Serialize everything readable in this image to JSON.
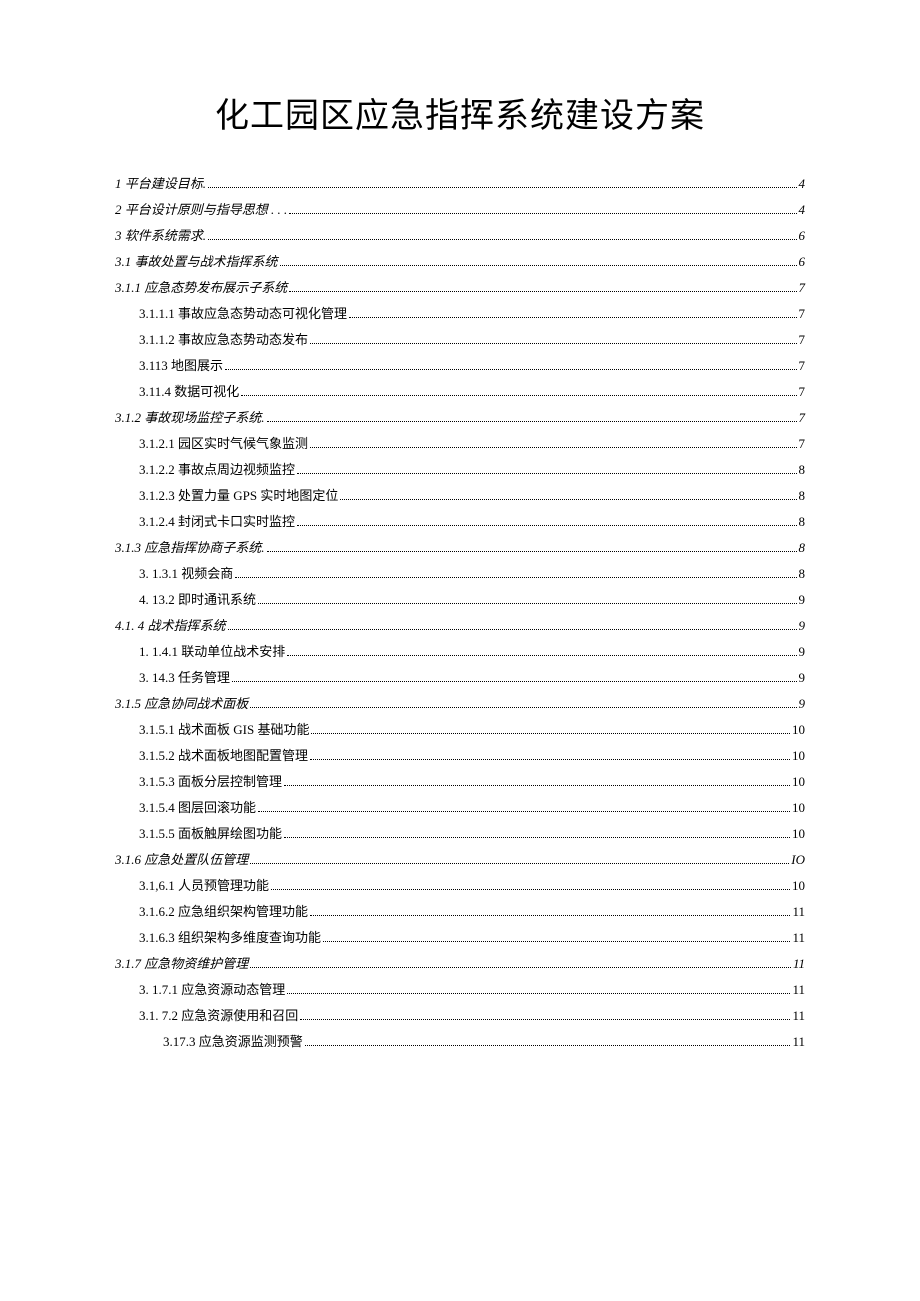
{
  "title": "化工园区应急指挥系统建设方案",
  "toc": [
    {
      "label": "1 平台建设目标.",
      "page": "4",
      "italic": true,
      "indent": 0
    },
    {
      "label": "2 平台设计原则与指导思想 . . .",
      "page": "4",
      "italic": true,
      "indent": 0
    },
    {
      "label": "3 软件系统需求.",
      "page": "6",
      "italic": true,
      "indent": 0
    },
    {
      "label": "3.1 事故处置与战术指挥系统",
      "page": "6",
      "italic": true,
      "indent": 0
    },
    {
      "label": "3.1.1 应急态势发布展示子系统",
      "page": "7",
      "italic": true,
      "indent": 0
    },
    {
      "label": "3.1.1.1 事故应急态势动态可视化管理",
      "page": "7",
      "italic": false,
      "indent": 2
    },
    {
      "label": "3.1.1.2 事故应急态势动态发布",
      "page": "7",
      "italic": false,
      "indent": 2
    },
    {
      "label": "3.113 地图展示",
      "page": "7",
      "italic": false,
      "indent": 2
    },
    {
      "label": "3.11.4 数据可视化",
      "page": "7",
      "italic": false,
      "indent": 2
    },
    {
      "label": "3.1.2 事故现场监控子系统.",
      "page": "7",
      "italic": true,
      "indent": 0
    },
    {
      "label": "3.1.2.1 园区实时气候气象监测",
      "page": "7",
      "italic": false,
      "indent": 2
    },
    {
      "label": "3.1.2.2 事故点周边视频监控",
      "page": "8",
      "italic": false,
      "indent": 2
    },
    {
      "label": "3.1.2.3 处置力量 GPS 实时地图定位",
      "page": " 8",
      "italic": false,
      "indent": 2
    },
    {
      "label": "3.1.2.4 封闭式卡口实时监控",
      "page": "8",
      "italic": false,
      "indent": 2
    },
    {
      "label": "3.1.3 应急指挥协商子系统.",
      "page": "8",
      "italic": true,
      "indent": 0
    },
    {
      "label": "3.   1.3.1 视频会商",
      "page": " 8",
      "italic": false,
      "indent": 2
    },
    {
      "label": "4.   13.2 即时通讯系统",
      "page": "9",
      "italic": false,
      "indent": 2
    },
    {
      "label": "4.1.    4 战术指挥系统",
      "page": "9",
      "italic": true,
      "indent": 0
    },
    {
      "label": "1.   1.4.1 联动单位战术安排",
      "page": "9",
      "italic": false,
      "indent": 2
    },
    {
      "label": "3.   14.3 任务管理",
      "page": "9",
      "italic": false,
      "indent": 2
    },
    {
      "label": "3.1.5 应急协同战术面板",
      "page": "9",
      "italic": true,
      "indent": 0
    },
    {
      "label": "3.1.5.1 战术面板 GIS 基础功能",
      "page": "10",
      "italic": false,
      "indent": 2
    },
    {
      "label": "3.1.5.2 战术面板地图配置管理",
      "page": "10",
      "italic": false,
      "indent": 2
    },
    {
      "label": "3.1.5.3 面板分层控制管理",
      "page": " 10",
      "italic": false,
      "indent": 2
    },
    {
      "label": "3.1.5.4 图层回滚功能",
      "page": "10",
      "italic": false,
      "indent": 2
    },
    {
      "label": "3.1.5.5 面板触屏绘图功能",
      "page": "10",
      "italic": false,
      "indent": 2
    },
    {
      "label": "3.1.6 应急处置队伍管理",
      "page": "IO",
      "italic": true,
      "indent": 0
    },
    {
      "label": "3.1,6.1 人员预管理功能",
      "page": "10",
      "italic": false,
      "indent": 2
    },
    {
      "label": "3.1.6.2 应急组织架构管理功能",
      "page": "11",
      "italic": false,
      "indent": 2
    },
    {
      "label": "3.1.6.3 组织架构多维度查询功能",
      "page": "11",
      "italic": false,
      "indent": 2
    },
    {
      "label": "3.1.7 应急物资维护管理",
      "page": " 11",
      "italic": true,
      "indent": 0
    },
    {
      "label": "3.   1.7.1 应急资源动态管理",
      "page": "11",
      "italic": false,
      "indent": 2
    },
    {
      "label": "3.1.    7.2 应急资源使用和召回",
      "page": "11",
      "italic": false,
      "indent": 2
    },
    {
      "label": "3.17.3 应急资源监测预警",
      "page": " 11",
      "italic": false,
      "indent": 3
    }
  ]
}
